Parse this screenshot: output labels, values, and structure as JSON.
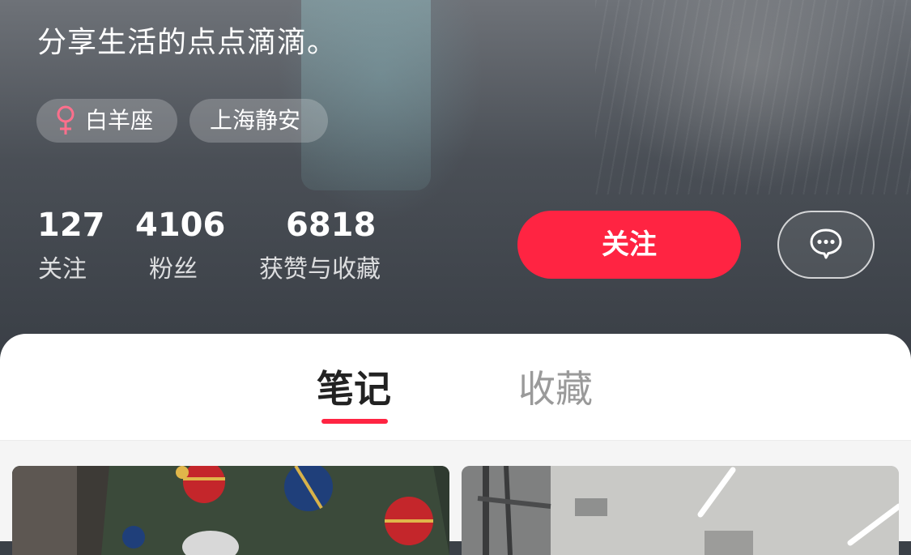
{
  "profile": {
    "bio": "分享生活的点点滴滴。",
    "tags": {
      "zodiac": "白羊座",
      "location": "上海静安"
    },
    "gender_icon_color": "#ff6f8c"
  },
  "stats": [
    {
      "value": "127",
      "label": "关注"
    },
    {
      "value": "4106",
      "label": "粉丝"
    },
    {
      "value": "6818",
      "label": "获赞与收藏"
    }
  ],
  "actions": {
    "follow_label": "关注",
    "message_icon": "chat-bubble-icon"
  },
  "tabs": [
    {
      "label": "笔记",
      "active": true
    },
    {
      "label": "收藏",
      "active": false
    }
  ],
  "colors": {
    "accent": "#ff2442",
    "inactive_tab": "#9a9a9a"
  }
}
